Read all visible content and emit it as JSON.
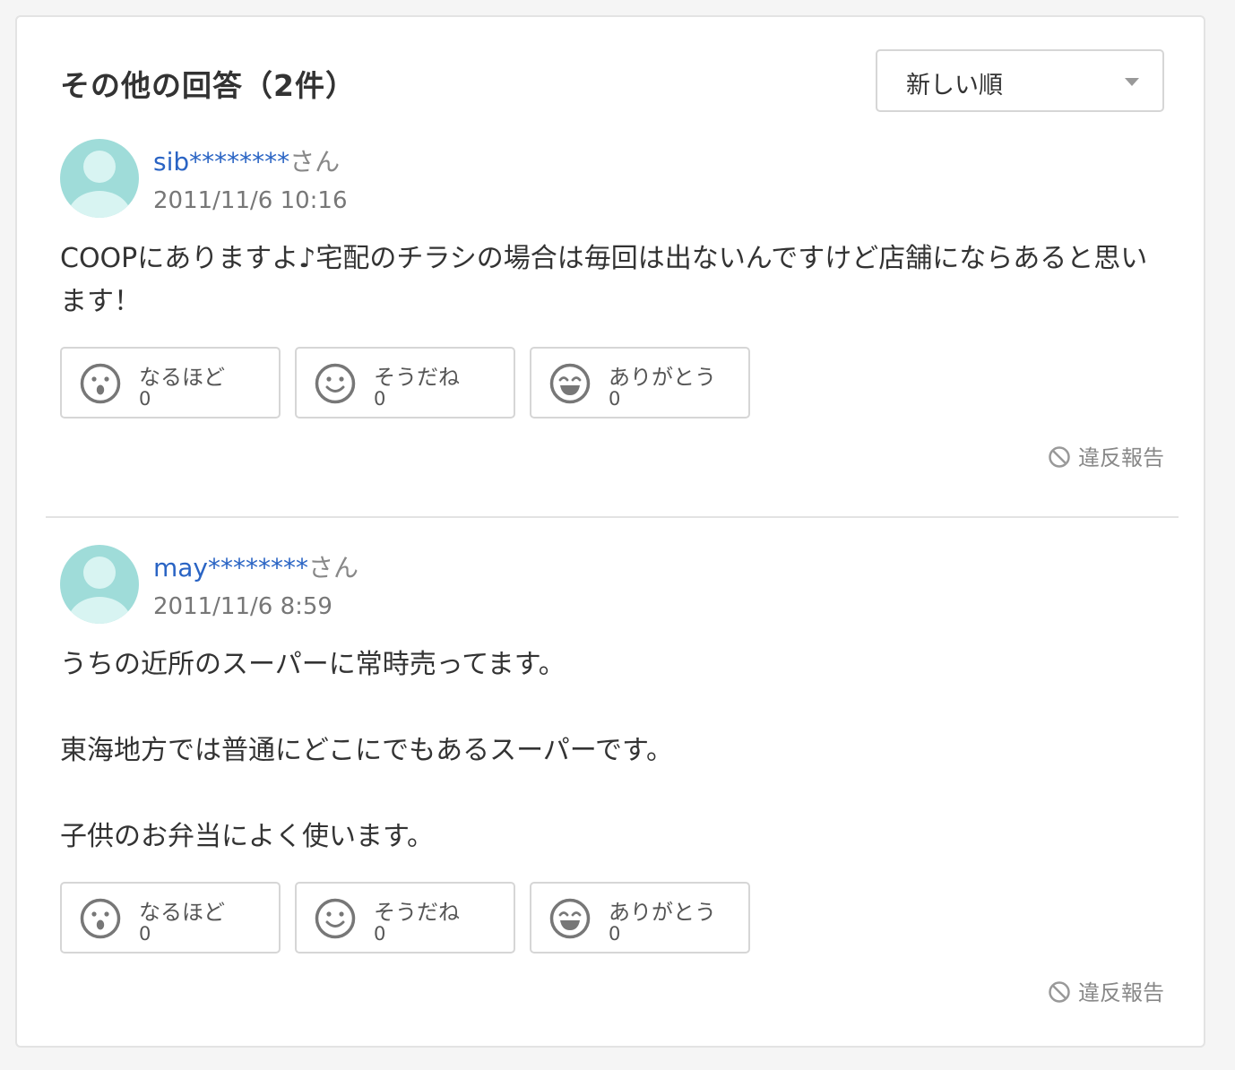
{
  "header": {
    "title": "その他の回答（2件）",
    "sort": {
      "selected": "新しい順"
    }
  },
  "answers": [
    {
      "user_name": "sib********",
      "user_suffix": "さん",
      "date": "2011/11/6 10:16",
      "body": [
        "COOPにありますよ♪宅配のチラシの場合は毎回は出ないんですけど店舗にならあると思います！"
      ],
      "reactions": [
        {
          "label": "なるほど",
          "count": "0",
          "icon": "surprised-face-icon"
        },
        {
          "label": "そうだね",
          "count": "0",
          "icon": "smile-face-icon"
        },
        {
          "label": "ありがとう",
          "count": "0",
          "icon": "grin-face-icon"
        }
      ],
      "report_label": "違反報告"
    },
    {
      "user_name": "may********",
      "user_suffix": "さん",
      "date": "2011/11/6 8:59",
      "body": [
        "うちの近所のスーパーに常時売ってます。",
        "",
        "東海地方では普通にどこにでもあるスーパーです。",
        "",
        "子供のお弁当によく使います。"
      ],
      "reactions": [
        {
          "label": "なるほど",
          "count": "0",
          "icon": "surprised-face-icon"
        },
        {
          "label": "そうだね",
          "count": "0",
          "icon": "smile-face-icon"
        },
        {
          "label": "ありがとう",
          "count": "0",
          "icon": "grin-face-icon"
        }
      ],
      "report_label": "違反報告"
    }
  ],
  "colors": {
    "username": "#2a64c4",
    "avatar_bg": "#9fdcd9",
    "avatar_fg": "#d8f4f2",
    "border": "#d6d6d6"
  }
}
